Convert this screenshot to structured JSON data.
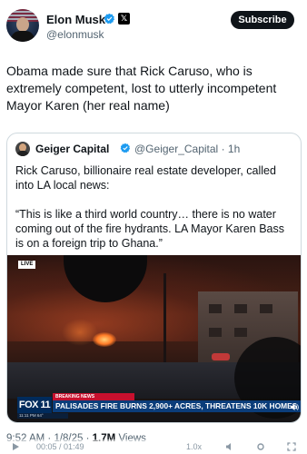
{
  "post": {
    "author": {
      "name": "Elon Musk",
      "handle": "@elonmusk"
    },
    "subscribe_label": "Subscribe",
    "text": "Obama made sure that Rick Caruso, who is extremely competent, lost to utterly incompetent Mayor Karen (her real name)",
    "time": "9:52 AM",
    "date": "1/8/25",
    "views_count": "1.7M",
    "views_label": "Views"
  },
  "quote": {
    "author": {
      "name": "Geiger Capital",
      "handle": "@Geiger_Capital",
      "age": "1h"
    },
    "paragraphs": [
      "Rick Caruso, billionaire real estate developer, called into LA local news:",
      "“This is like a third world country… there is no water coming out of the fire hydrants. LA Mayor Karen Bass is on a foreign trip to Ghana.”"
    ],
    "video": {
      "live_badge": "LIVE",
      "channel_logo": "FOX 11",
      "breaking_label": "BREAKING NEWS",
      "headline": "PALISADES FIRE BURNS 2,900+ ACRES, THREATENS 10K HOMES",
      "ticker": "11:11 PM  64°"
    }
  },
  "player": {
    "time": "00:05 / 01:49",
    "speed": "1.0x"
  },
  "colors": {
    "verified_blue": "#1d9bf0",
    "text_secondary": "#536471",
    "border": "#cfd9de",
    "breaking_red": "#c8102e",
    "headline_blue": "#0b3d7a"
  },
  "icons": {
    "verified": "verified-badge-icon",
    "x_affiliation": "x-logo-icon",
    "mute": "speaker-icon",
    "player_volume": "volume-icon",
    "player_settings": "settings-icon",
    "player_fullscreen": "fullscreen-icon"
  }
}
